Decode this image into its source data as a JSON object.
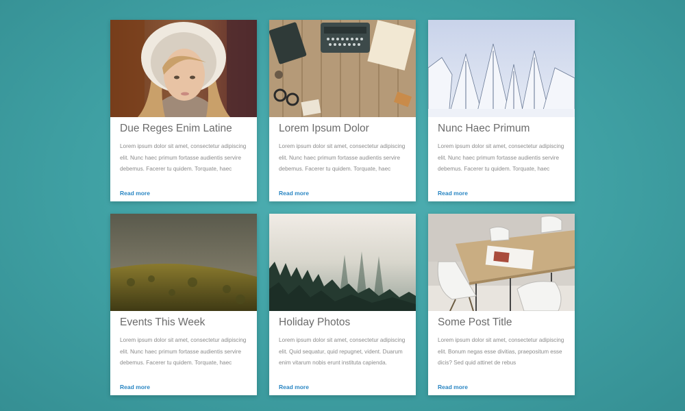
{
  "cards": [
    {
      "title": "Due Reges Enim Latine",
      "text": "Lorem ipsum dolor sit amet, consectetur adipiscing elit. Nunc haec primum fortasse audientis servire debemus. Facerer tu quidem. Torquate, haec",
      "link": "Read more",
      "image_icon": "photo-girl-in-hood"
    },
    {
      "title": "Lorem Ipsum Dolor",
      "text": "Lorem ipsum dolor sit amet, consectetur adipiscing elit. Nunc haec primum fortasse audientis servire debemus. Facerer tu quidem. Torquate, haec",
      "link": "Read more",
      "image_icon": "photo-desk-typewriter"
    },
    {
      "title": "Nunc Haec Primum",
      "text": "Lorem ipsum dolor sit amet, consectetur adipiscing elit. Nunc haec primum fortasse audientis servire debemus. Facerer tu quidem. Torquate, haec",
      "link": "Read more",
      "image_icon": "photo-snowy-trees"
    },
    {
      "title": "Events This Week",
      "text": "Lorem ipsum dolor sit amet, consectetur adipiscing elit. Nunc haec primum fortasse audientis servire debemus. Facerer tu quidem. Torquate, haec",
      "link": "Read more",
      "image_icon": "photo-foggy-hill"
    },
    {
      "title": "Holiday Photos",
      "text": "Lorem ipsum dolor sit amet, consectetur adipiscing elit. Quid sequatur, quid repugnet, vident. Duarum enim vitarum nobis erunt instituta capienda.",
      "link": "Read more",
      "image_icon": "photo-misty-forest"
    },
    {
      "title": "Some Post Title",
      "text": "Lorem ipsum dolor sit amet, consectetur adipiscing elit. Bonum negas esse divitias, praepositum esse dicis? Sed quid attinet de rebus",
      "link": "Read more",
      "image_icon": "photo-table-chairs"
    }
  ],
  "colors": {
    "background": "#43a5a8",
    "link": "#2a86c3",
    "title": "#6b6b6b",
    "body_text": "#8a8a8a"
  }
}
